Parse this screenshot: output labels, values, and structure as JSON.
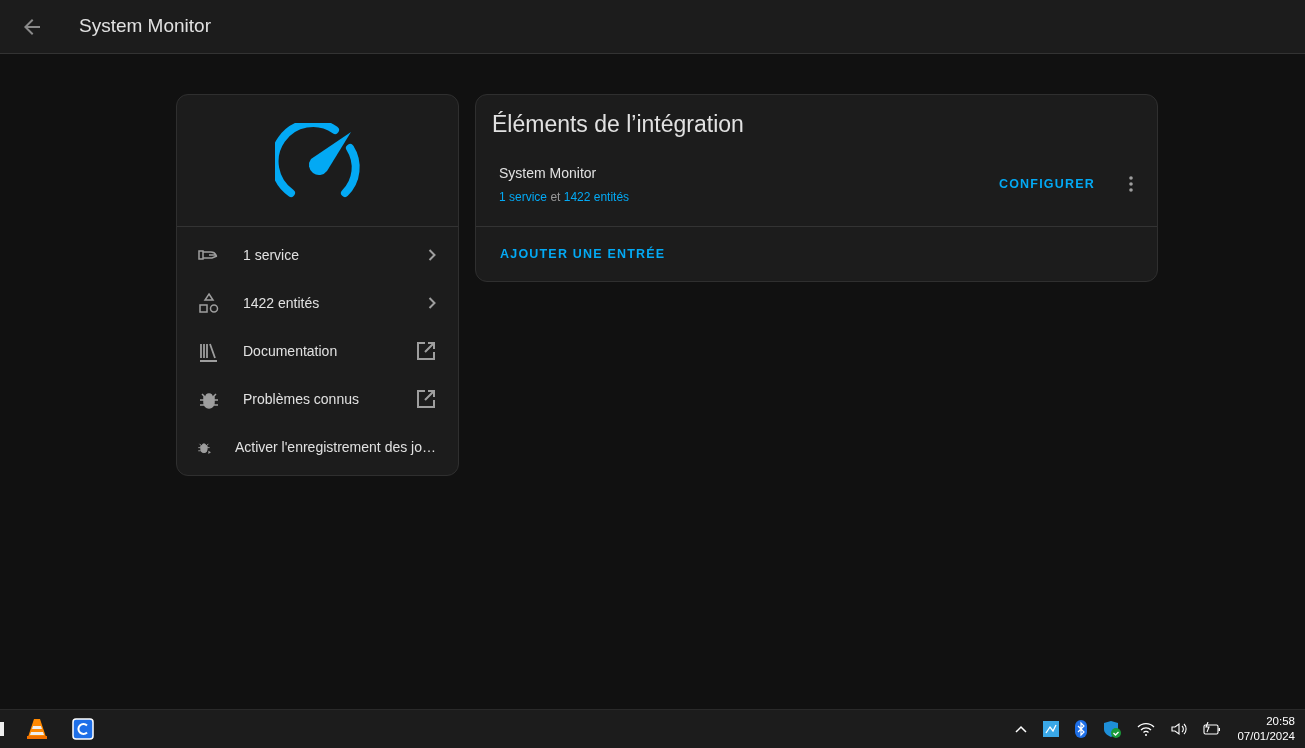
{
  "header": {
    "title": "System Monitor"
  },
  "info_card": {
    "items": [
      {
        "label": "1 service",
        "kind": "chevron"
      },
      {
        "label": "1422 entités",
        "kind": "chevron"
      },
      {
        "label": "Documentation",
        "kind": "external"
      },
      {
        "label": "Problèmes connus",
        "kind": "external"
      },
      {
        "label": "Activer l'enregistrement des jo…",
        "kind": "plain"
      }
    ]
  },
  "entries_card": {
    "title": "Éléments de l’intégration",
    "entries": [
      {
        "name": "System Monitor",
        "subtitle_parts": [
          {
            "text": "1 service",
            "kind": "link"
          },
          {
            "text": "et",
            "kind": "text"
          },
          {
            "text": "1422 entités",
            "kind": "link"
          }
        ],
        "action": "CONFIGURER"
      }
    ],
    "footer_action": "AJOUTER UNE ENTRÉE"
  },
  "taskbar": {
    "time": "20:58",
    "date": "07/01/2024"
  }
}
